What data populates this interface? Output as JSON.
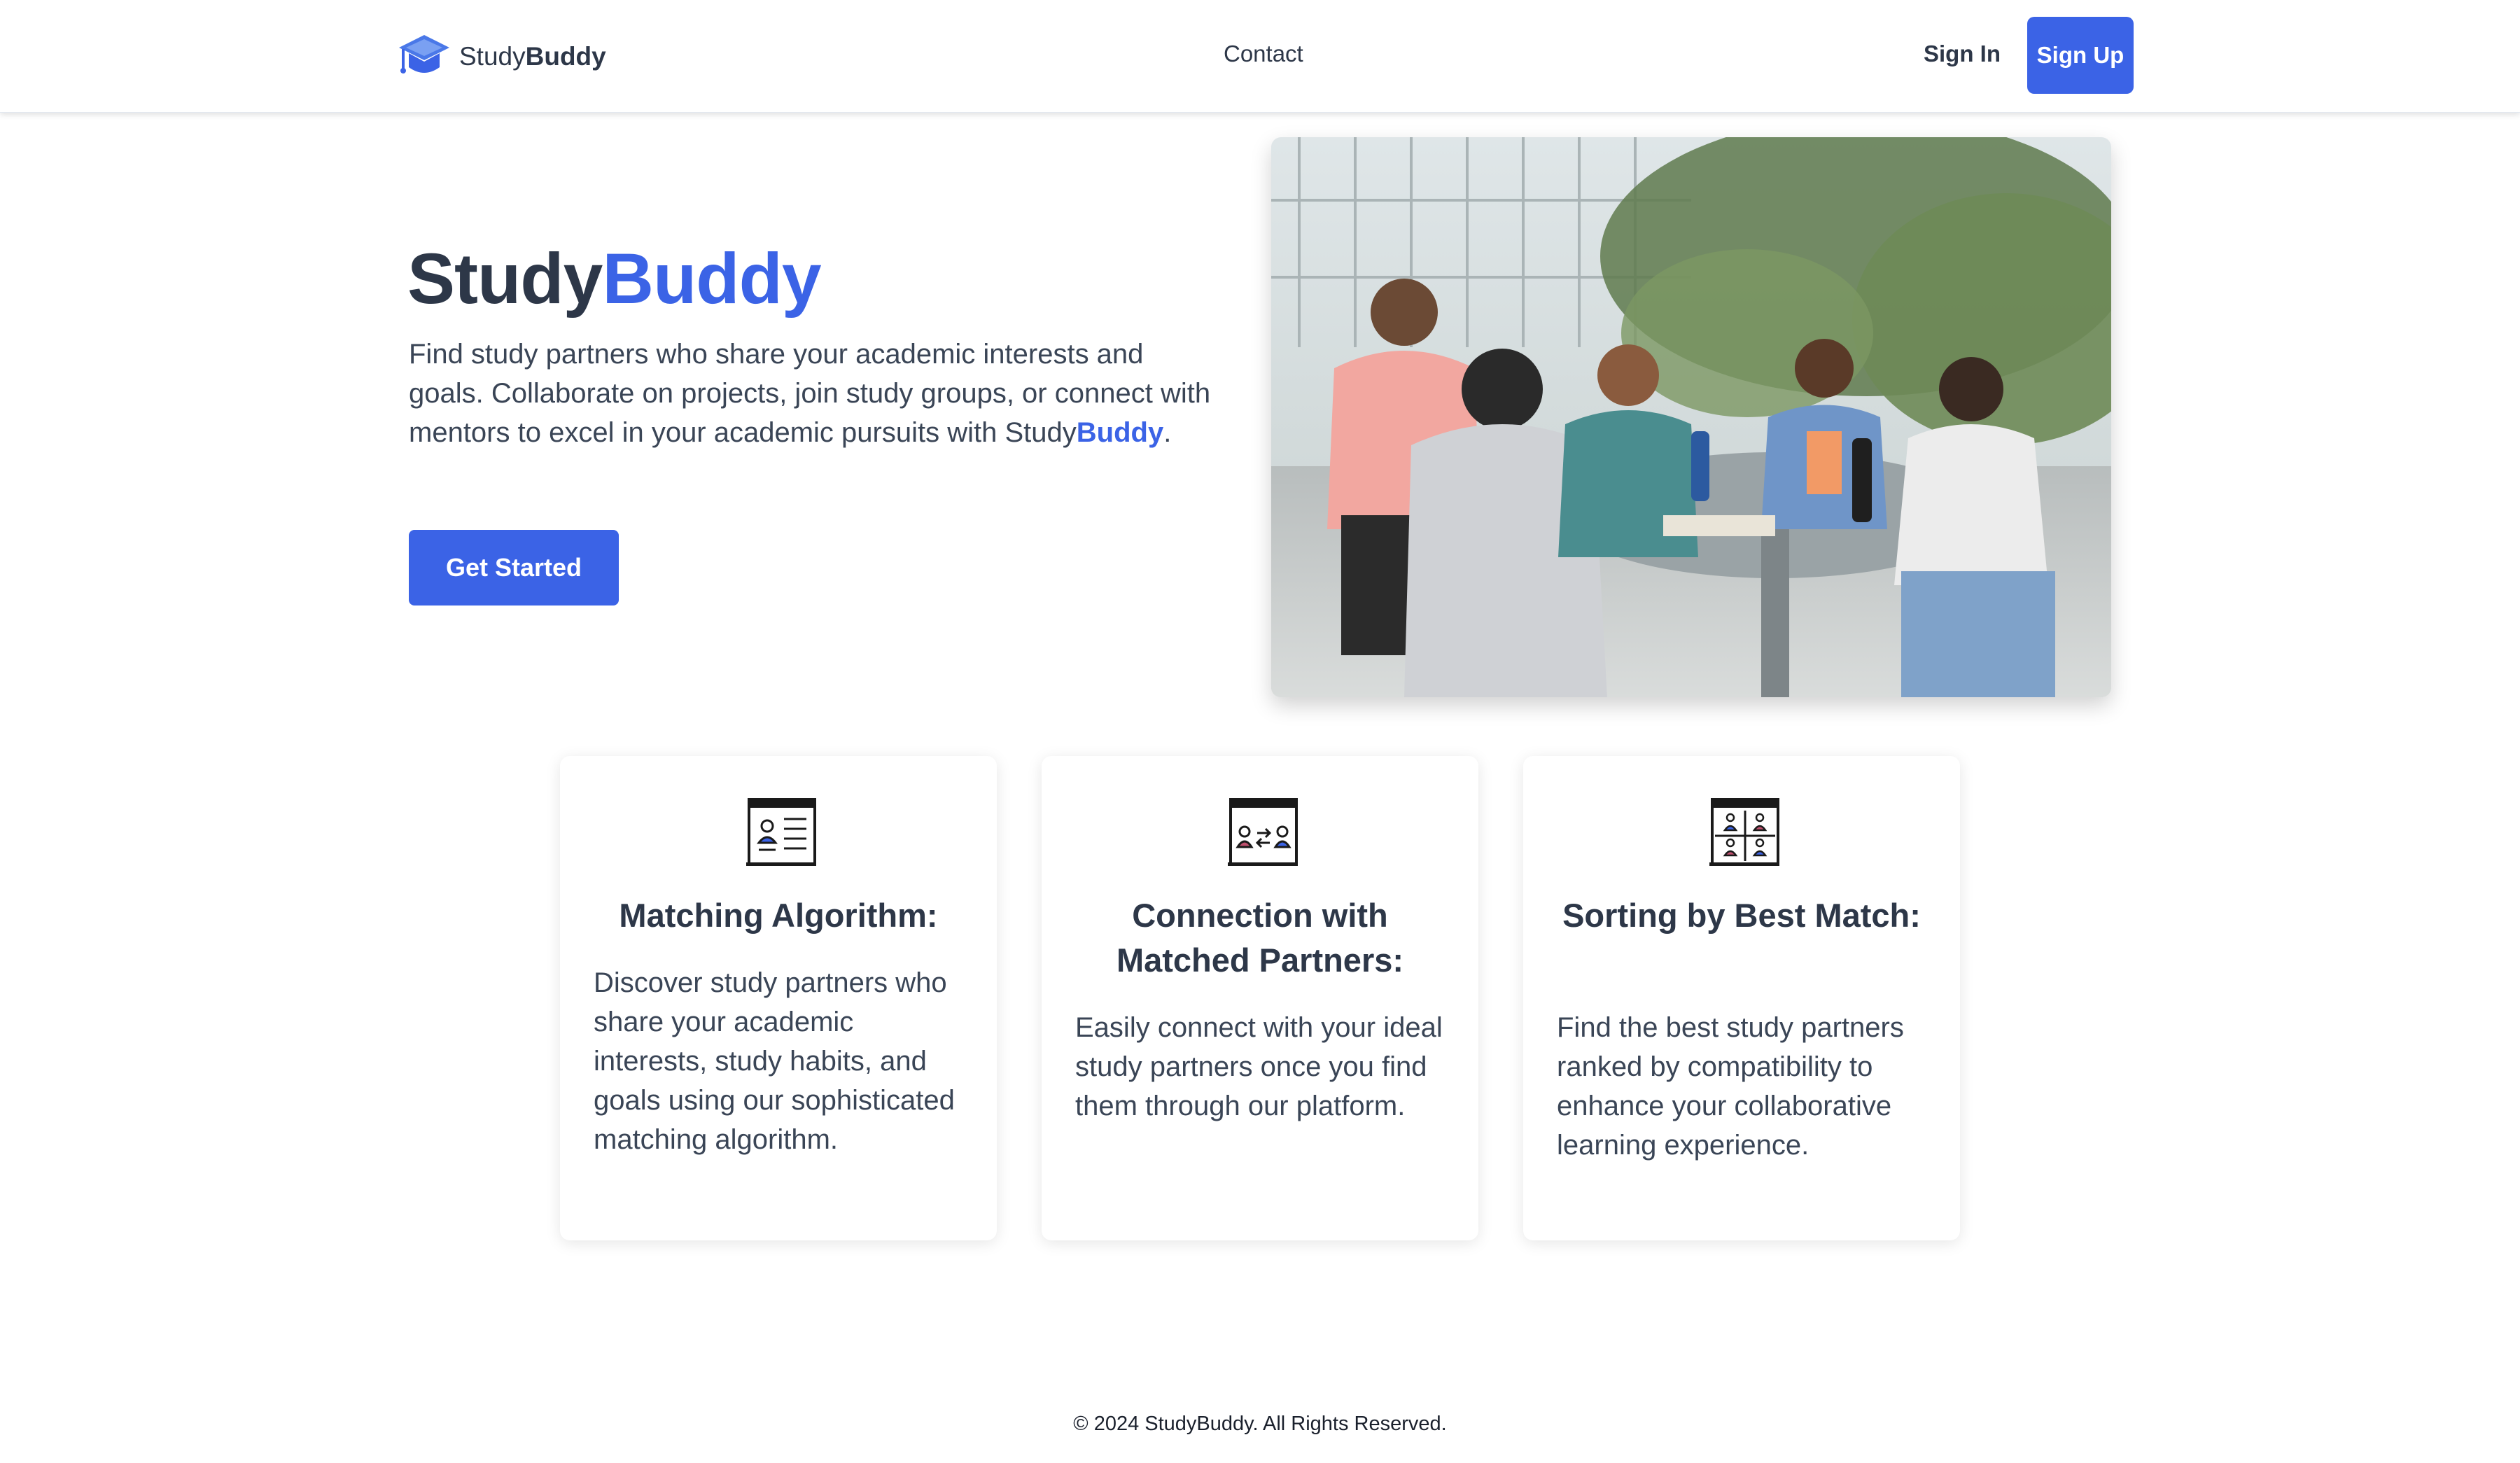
{
  "nav": {
    "brand_regular": "Study",
    "brand_bold": "Buddy",
    "contact": "Contact",
    "sign_in": "Sign In",
    "sign_up": "Sign Up"
  },
  "hero": {
    "title_regular": "Study",
    "title_accent": "Buddy",
    "description": "Find study partners who share your academic interests and goals. Collaborate on projects, join study groups, or connect with mentors to excel in your academic pursuits with ",
    "desc_brand_regular": "Study",
    "desc_brand_accent": "Buddy",
    "desc_end": ".",
    "cta": "Get Started"
  },
  "features": [
    {
      "icon": "profile-list-icon",
      "title": "Matching Algorithm:",
      "text": "Discover study partners who share your academic interests, study habits, and goals using our sophisticated matching algorithm."
    },
    {
      "icon": "connect-people-icon",
      "title": "Connection with Matched Partners:",
      "text": "Easily connect with your ideal study partners once you find them through our platform."
    },
    {
      "icon": "people-grid-icon",
      "title": "Sorting by Best Match:",
      "text": "Find the best study partners ranked by compatibility to enhance your collaborative learning experience."
    }
  ],
  "footer": "© 2024 StudyBuddy. All Rights Reserved.",
  "colors": {
    "accent": "#3b63e6",
    "text": "#2d3748"
  }
}
